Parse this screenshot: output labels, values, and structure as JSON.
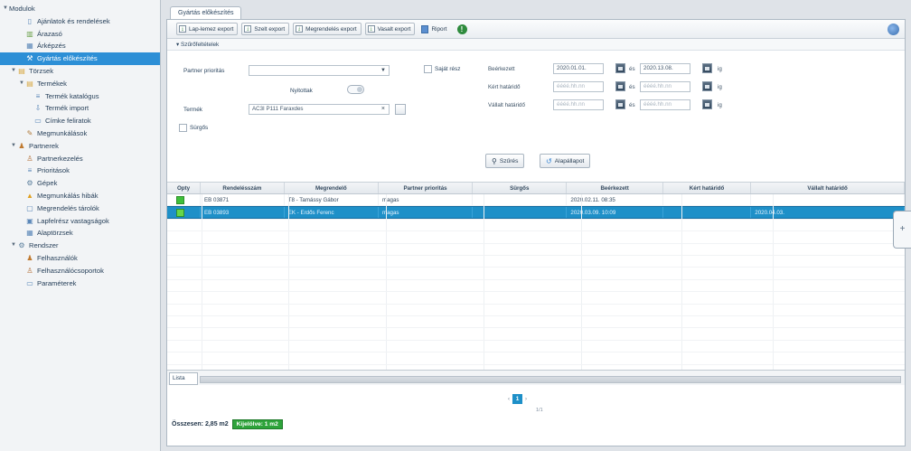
{
  "colors": {
    "accent": "#2d8fd6",
    "selected_row": "#1e90c8",
    "ok_green": "#3fbf3a",
    "badge_green": "#2da33a"
  },
  "sidebar": {
    "items": [
      {
        "label": "Modulok",
        "level": 0,
        "arrow": "down",
        "icon": "none"
      },
      {
        "label": "Ajánlatok és rendelések",
        "level": 2,
        "arrow": "",
        "icon": "document-icon"
      },
      {
        "label": "Árazasó",
        "level": 2,
        "arrow": "",
        "icon": "chart-icon"
      },
      {
        "label": "Árképzés",
        "level": 2,
        "arrow": "",
        "icon": "table-icon"
      },
      {
        "label": "Gyártás előkészítés",
        "level": 2,
        "arrow": "",
        "icon": "factory-icon",
        "selected": true
      },
      {
        "label": "Törzsek",
        "level": 1,
        "arrow": "down",
        "icon": "folder-icon"
      },
      {
        "label": "Termékek",
        "level": 2,
        "arrow": "down",
        "icon": "folder-icon"
      },
      {
        "label": "Termék katalógus",
        "level": 3,
        "arrow": "",
        "icon": "list-icon"
      },
      {
        "label": "Termék import",
        "level": 3,
        "arrow": "",
        "icon": "import-icon"
      },
      {
        "label": "Címke feliratok",
        "level": 3,
        "arrow": "",
        "icon": "label-icon"
      },
      {
        "label": "Megmunkálások",
        "level": 2,
        "arrow": "",
        "icon": "tool-icon"
      },
      {
        "label": "Partnerek",
        "level": 1,
        "arrow": "down",
        "icon": "user-icon"
      },
      {
        "label": "Partnerkezelés",
        "level": 2,
        "arrow": "",
        "icon": "user-group-icon"
      },
      {
        "label": "Prioritások",
        "level": 2,
        "arrow": "",
        "icon": "list-icon"
      },
      {
        "label": "Gépek",
        "level": 2,
        "arrow": "",
        "icon": "machine-icon"
      },
      {
        "label": "Megmunkálás hibák",
        "level": 2,
        "arrow": "",
        "icon": "warning-icon"
      },
      {
        "label": "Megrendelés tárolók",
        "level": 2,
        "arrow": "",
        "icon": "box-icon"
      },
      {
        "label": "Lapfelrész vastagságok",
        "level": 2,
        "arrow": "",
        "icon": "layers-icon"
      },
      {
        "label": "Alaptörzsek",
        "level": 2,
        "arrow": "",
        "icon": "grid-icon"
      },
      {
        "label": "Rendszer",
        "level": 1,
        "arrow": "down",
        "icon": "gear-icon"
      },
      {
        "label": "Felhasználók",
        "level": 2,
        "arrow": "",
        "icon": "user-icon"
      },
      {
        "label": "Felhasználócsoportok",
        "level": 2,
        "arrow": "",
        "icon": "user-group-icon"
      },
      {
        "label": "Paraméterek",
        "level": 2,
        "arrow": "",
        "icon": "settings-icon"
      }
    ]
  },
  "tab": {
    "label": "Gyártás előkészítés"
  },
  "toolbar": {
    "buttons": [
      {
        "label": "Lap-lemez export",
        "icon": "export-icon"
      },
      {
        "label": "Szelt export",
        "icon": "export-icon"
      },
      {
        "label": "Megrendelés export",
        "icon": "export-icon"
      },
      {
        "label": "Vasalt export",
        "icon": "export-icon"
      }
    ],
    "report_label": "Riport"
  },
  "filter": {
    "header": "Szűrőfeltételek",
    "partner_label": "Partner prioritás",
    "partner_value": "",
    "active_label": "Nyitottak",
    "product_label": "Termék",
    "product_value": "AC3I P111 Faraxdes",
    "rush_label": "Sürgős",
    "own_label": "Saját rész",
    "received_label": "Beérkezett",
    "received_from": "2020.01.01.",
    "received_to": "2020.13.08.",
    "sep": "és",
    "tail": "ig",
    "requested_label": "Kért határidő",
    "accepted_label": "Vállalt határidő",
    "date_placeholder": "éééé.hh.nn",
    "search_label": "Szűrés",
    "reset_label": "Alapállapot"
  },
  "grid": {
    "columns": [
      "Opty",
      "Rendelésszám",
      "Megrendelő",
      "Partner prioritás",
      "Sürgős",
      "Beérkezett",
      "Kért határidő",
      "Vállalt határidő"
    ],
    "rows": [
      {
        "order": "EB 03871",
        "customer": "T8 - Tamássy Gábor",
        "priority": "magas",
        "urgent": "",
        "received": "2020.02.11. 08:35",
        "requested": "",
        "accepted": "",
        "selected": false
      },
      {
        "order": "EB 03893",
        "customer": "EK - Erdős Ferenc",
        "priority": "magas",
        "urgent": "",
        "received": "2020.03.09. 10:09",
        "requested": "",
        "accepted": "2020.04.03.",
        "selected": true
      }
    ]
  },
  "list_tab": "Lista",
  "pager": {
    "prev": "‹",
    "page": "1",
    "next": "›",
    "sub": "1/1"
  },
  "status": {
    "label": "Összesen: 2,85 m2",
    "badge": "Kijelölve: 1 m2"
  }
}
